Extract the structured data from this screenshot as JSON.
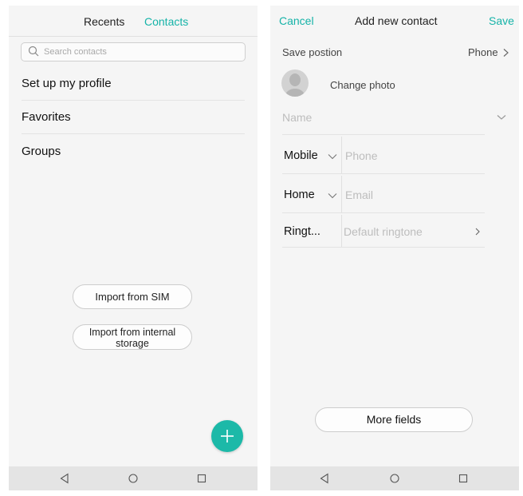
{
  "left": {
    "tabs": {
      "recents": "Recents",
      "contacts": "Contacts"
    },
    "search": {
      "placeholder": "Search contacts"
    },
    "items": [
      "Set up my profile",
      "Favorites",
      "Groups"
    ],
    "import_sim": "Import from SIM",
    "import_internal_line1": "Import from internal",
    "import_internal_line2": "storage",
    "fab_icon": "plus-icon"
  },
  "right": {
    "cancel": "Cancel",
    "title": "Add new contact",
    "save": "Save",
    "save_position_label": "Save postion",
    "save_position_value": "Phone",
    "change_photo": "Change photo",
    "name_placeholder": "Name",
    "mobile_label": "Mobile",
    "phone_placeholder": "Phone",
    "home_label": "Home",
    "email_placeholder": "Email",
    "ringtone_label": "Ringt...",
    "ringtone_value": "Default ringtone",
    "more_fields": "More fields"
  },
  "colors": {
    "accent": "#15b3a8",
    "fab": "#1cb9a8"
  },
  "navbar_icons": [
    "back-icon",
    "home-icon",
    "recents-icon"
  ]
}
